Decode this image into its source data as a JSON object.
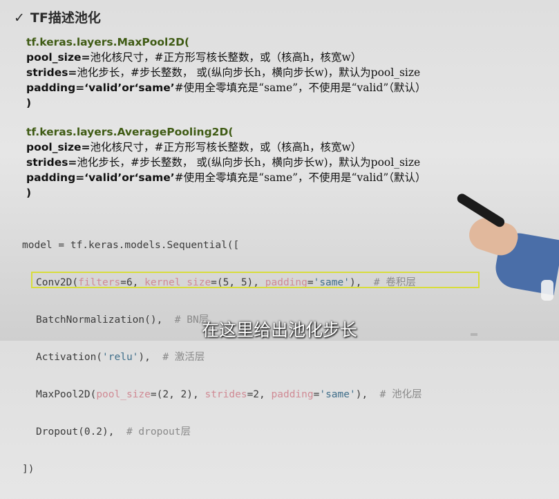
{
  "title": {
    "check": "✓",
    "text": "TF描述池化"
  },
  "block1": {
    "head": "tf.keras.layers.MaxPool2D(",
    "l1_kw": "pool_size=",
    "l1_cm": "池化核尺寸，#正方形写核长整数，或（核高h，核宽w）",
    "l2_kw": "strides=",
    "l2_cm": "池化步长，#步长整数， 或(纵向步长h，横向步长w)，默认为pool_size",
    "l3_kw": "padding=‘valid’or‘same’",
    "l3_cm": "#使用全零填充是“same”，不使用是“valid”（默认）",
    "close": ")"
  },
  "block2": {
    "head": "tf.keras.layers.AveragePooling2D(",
    "l1_kw": "pool_size=",
    "l1_cm": "池化核尺寸，#正方形写核长整数，或（核高h，核宽w）",
    "l2_kw": "strides=",
    "l2_cm": "池化步长，#步长整数， 或(纵向步长h，横向步长w)，默认为pool_size",
    "l3_kw": "padding=‘valid’or‘same’",
    "l3_cm": "#使用全零填充是“same”，不使用是“valid”（默认）",
    "close": ")"
  },
  "code": {
    "line0": "model = tf.keras.models.Sequential([",
    "conv": {
      "a": "Conv2D(",
      "p1": "filters",
      "b": "=6, ",
      "p2": "kernel_size",
      "c": "=(5, 5), ",
      "p3": "padding",
      "d": "=",
      "s": "'same'",
      "e": "),  ",
      "cm": "# 卷积层"
    },
    "bn": {
      "a": "BatchNormalization(),  ",
      "cm": "# BN层"
    },
    "act": {
      "a": "Activation(",
      "s": "'relu'",
      "b": "),  ",
      "cm": "# 激活层"
    },
    "pool": {
      "a": "MaxPool2D(",
      "p1": "pool_size",
      "b": "=(2, 2), ",
      "p2": "strides",
      "c": "=2, ",
      "p3": "padding",
      "d": "=",
      "s": "'same'",
      "e": "),  ",
      "cm": "# 池化层"
    },
    "drop": {
      "a": "Dropout(0.2),  ",
      "cm": "# dropout层"
    },
    "close": "])"
  },
  "subtitle": "在这里给出池化步长"
}
